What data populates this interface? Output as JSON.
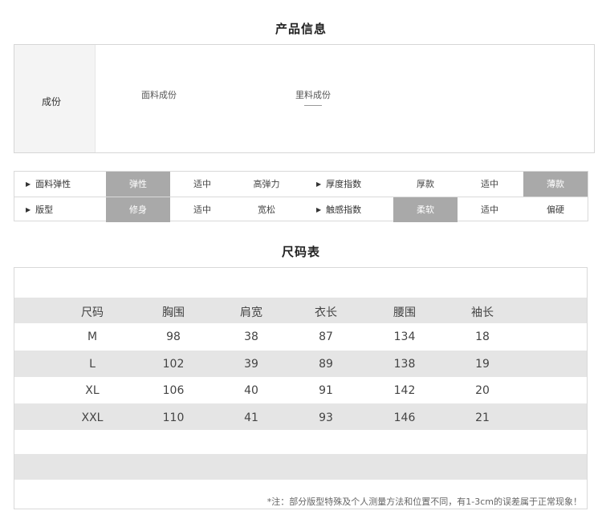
{
  "info": {
    "title": "产品信息",
    "label": "成份",
    "fabric_label": "面料成份",
    "lining_label": "里料成份"
  },
  "attributes": [
    {
      "name": "面料弹性",
      "options": [
        "弹性",
        "适中",
        "高弹力"
      ],
      "selected": "弹性"
    },
    {
      "name": "厚度指数",
      "options": [
        "厚款",
        "适中",
        "薄款"
      ],
      "selected": "薄款"
    },
    {
      "name": "版型",
      "options": [
        "修身",
        "适中",
        "宽松"
      ],
      "selected": "修身"
    },
    {
      "name": "触感指数",
      "options": [
        "柔软",
        "适中",
        "偏硬"
      ],
      "selected": "柔软"
    }
  ],
  "size_table": {
    "title": "尺码表",
    "headers": [
      "尺码",
      "胸围",
      "肩宽",
      "衣长",
      "腰围",
      "袖长"
    ],
    "rows": [
      [
        "M",
        "98",
        "38",
        "87",
        "134",
        "18"
      ],
      [
        "L",
        "102",
        "39",
        "89",
        "138",
        "19"
      ],
      [
        "XL",
        "106",
        "40",
        "91",
        "142",
        "20"
      ],
      [
        "XXL",
        "110",
        "41",
        "93",
        "146",
        "21"
      ]
    ],
    "note": "*注：部分版型特殊及个人测量方法和位置不同，有1-3cm的误差属于正常现象！"
  },
  "colors": {
    "selected_option_bg": "#a9a9a9",
    "band_grey": "#e5e5e5"
  }
}
